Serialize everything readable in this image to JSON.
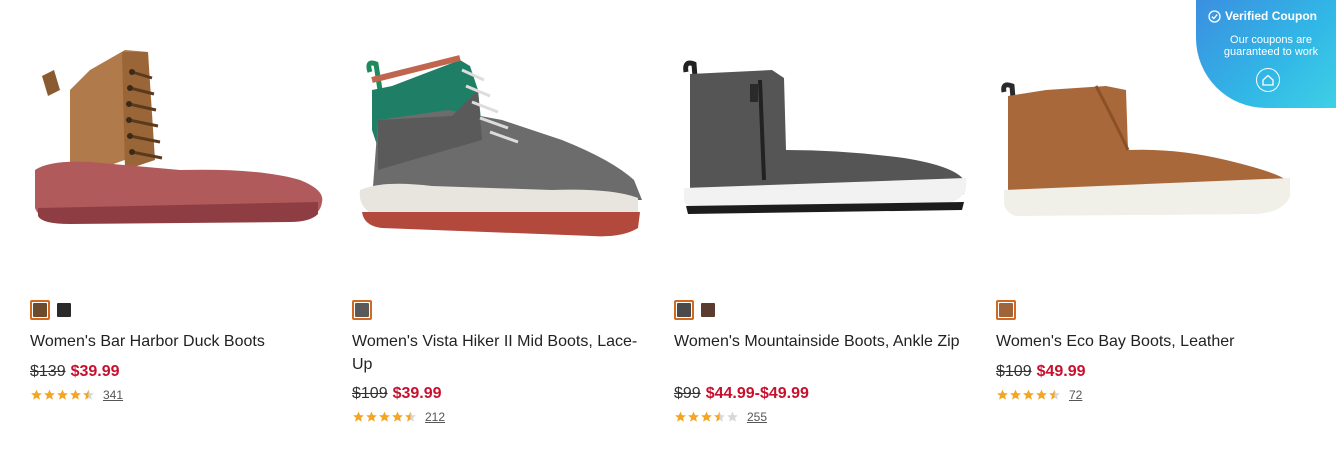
{
  "products": [
    {
      "name": "Women's Bar Harbor Duck Boots",
      "orig_price": "$139",
      "sale_price": "$39.99",
      "rating": 4.5,
      "review_count": "341",
      "swatches": [
        "#6b4a2e",
        "#2a2a2a"
      ]
    },
    {
      "name": "Women's Vista Hiker II Mid Boots, Lace-Up",
      "orig_price": "$109",
      "sale_price": "$39.99",
      "rating": 4.5,
      "review_count": "212",
      "swatches": [
        "#5a5a5a"
      ]
    },
    {
      "name": "Women's Mountainside Boots, Ankle Zip",
      "orig_price": "$99",
      "sale_price": "$44.99-$49.99",
      "rating": 3.5,
      "review_count": "255",
      "swatches": [
        "#4a4a4a",
        "#5a3b30"
      ]
    },
    {
      "name": "Women's Eco Bay Boots, Leather",
      "orig_price": "$109",
      "sale_price": "$49.99",
      "rating": 4.5,
      "review_count": "72",
      "swatches": [
        "#a0643a"
      ]
    }
  ],
  "coupon": {
    "title": "Verified Coupon",
    "subtitle": "Our coupons are guaranteed to work"
  },
  "colors": {
    "sale": "#c8102e",
    "star": "#f4a623",
    "swatch_selected_border": "#d2691e"
  }
}
